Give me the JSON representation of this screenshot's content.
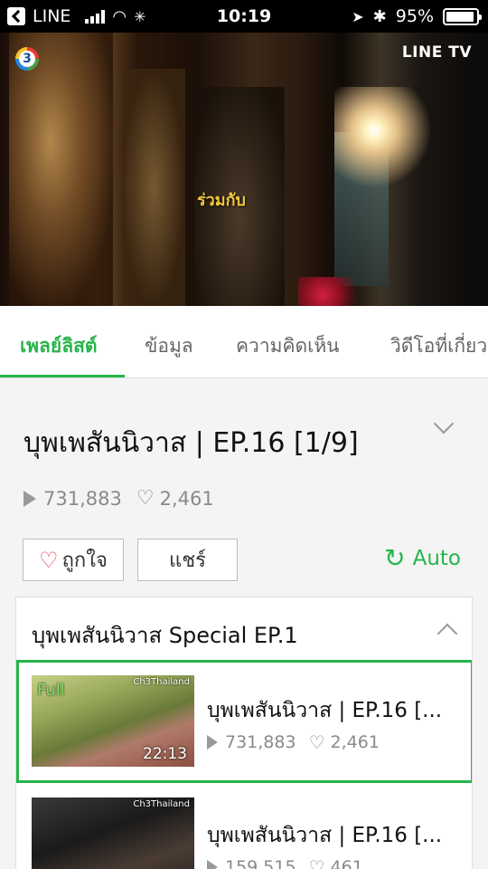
{
  "status_bar": {
    "carrier": "LINE",
    "time": "10:19",
    "battery": "95%"
  },
  "video": {
    "channel_badge": "3",
    "brand": "LINE TV",
    "caption": "ร่วมกับ"
  },
  "tabs": [
    {
      "label": "เพลย์ลิสต์",
      "active": true
    },
    {
      "label": "ข้อมูล",
      "active": false
    },
    {
      "label": "ความคิดเห็น",
      "active": false
    },
    {
      "label": "วิดีโอที่เกี่ยว",
      "active": false
    }
  ],
  "info": {
    "title": "บุพเพสันนิวาส | EP.16 [1/9]",
    "views": "731,883",
    "likes": "2,461",
    "like_button": "ถูกใจ",
    "share_button": "แชร์",
    "auto_label": "Auto"
  },
  "playlist": {
    "title": "บุพเพสันนิวาส Special EP.1",
    "items": [
      {
        "badge": "Full",
        "channel": "Ch3Thailand",
        "duration": "22:13",
        "title": "บุพเพสันนิวาส | EP.16 [...",
        "views": "731,883",
        "likes": "2,461",
        "selected": true
      },
      {
        "channel": "Ch3Thailand",
        "duration": "",
        "title": "บุพเพสันนิวาส | EP.16 [...",
        "views": "159,515",
        "likes": "461",
        "selected": false
      }
    ]
  },
  "colors": {
    "accent": "#25b54a",
    "heart": "#e04a5c"
  }
}
